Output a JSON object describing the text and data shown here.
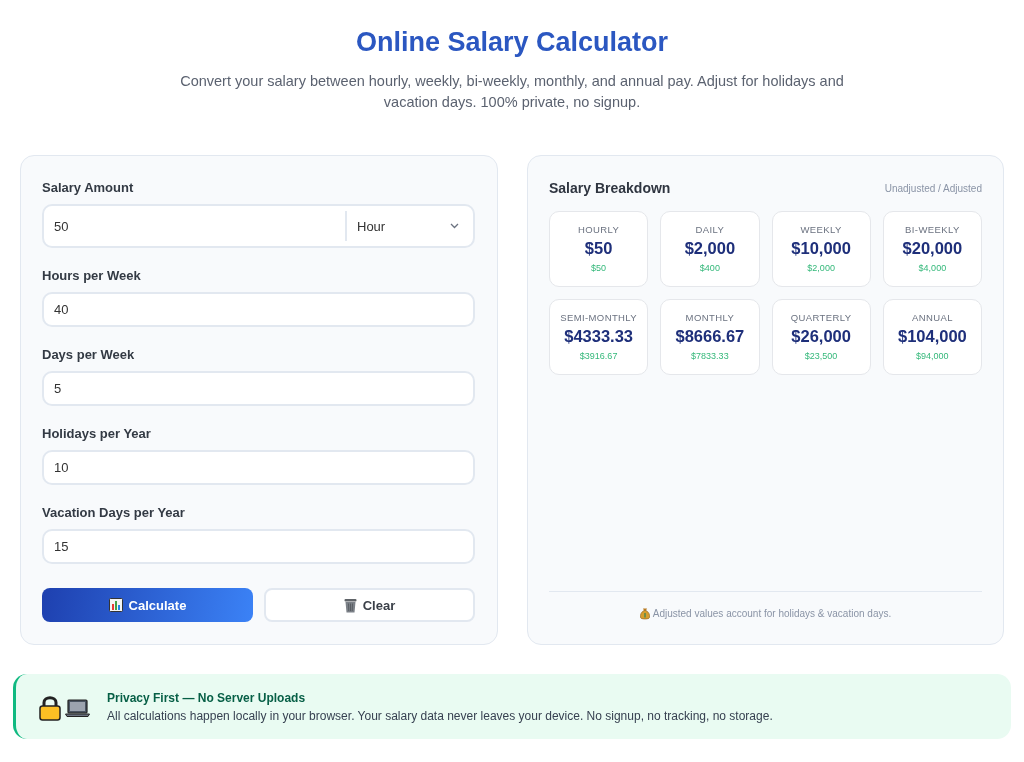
{
  "header": {
    "title": "Online Salary Calculator",
    "subtitle": "Convert your salary between hourly, weekly, bi-weekly, monthly, and annual pay. Adjust for holidays and vacation days. 100% private, no signup."
  },
  "form": {
    "fields": [
      {
        "kind": "amount",
        "label": "Salary Amount",
        "value": "50",
        "unit": "Hour"
      },
      {
        "kind": "number",
        "label": "Hours per Week",
        "value": "40"
      },
      {
        "kind": "number",
        "label": "Days per Week",
        "value": "5"
      },
      {
        "kind": "number",
        "label": "Holidays per Year",
        "value": "10"
      },
      {
        "kind": "number",
        "label": "Vacation Days per Year",
        "value": "15"
      }
    ],
    "buttons": [
      {
        "kind": "primary",
        "label": "Calculate"
      },
      {
        "kind": "secondary",
        "label": "Clear"
      }
    ]
  },
  "breakdown": {
    "title": "Salary Breakdown",
    "legend": "Unadjusted / Adjusted",
    "cards": [
      {
        "period": "HOURLY",
        "unadjusted": "$50",
        "adjusted": "$50"
      },
      {
        "period": "DAILY",
        "unadjusted": "$2,000",
        "adjusted": "$400"
      },
      {
        "period": "WEEKLY",
        "unadjusted": "$10,000",
        "adjusted": "$2,000"
      },
      {
        "period": "BI-WEEKLY",
        "unadjusted": "$20,000",
        "adjusted": "$4,000"
      },
      {
        "period": "SEMI-MONTHLY",
        "unadjusted": "$4333.33",
        "adjusted": "$3916.67"
      },
      {
        "period": "MONTHLY",
        "unadjusted": "$8666.67",
        "adjusted": "$7833.33"
      },
      {
        "period": "QUARTERLY",
        "unadjusted": "$26,000",
        "adjusted": "$23,500"
      },
      {
        "period": "ANNUAL",
        "unadjusted": "$104,000",
        "adjusted": "$94,000"
      }
    ],
    "note": "Adjusted values account for holidays & vacation days."
  },
  "privacy_notice": {
    "title": "Privacy First — No Server Uploads",
    "text": "All calculations happen locally in your browser. Your salary data never leaves your device. No signup, no tracking, no storage."
  }
}
